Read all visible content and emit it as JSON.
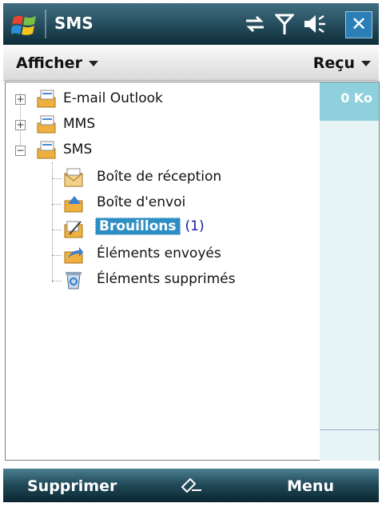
{
  "titlebar": {
    "title": "SMS"
  },
  "menubar": {
    "left_label": "Afficher",
    "right_label": "Reçu"
  },
  "tree": {
    "accounts": [
      {
        "label": "E-mail Outlook",
        "expanded": false
      },
      {
        "label": "MMS",
        "expanded": false
      },
      {
        "label": "SMS",
        "expanded": true
      }
    ],
    "folders": [
      {
        "label": "Boîte de réception",
        "icon": "inbox-icon"
      },
      {
        "label": "Boîte d'envoi",
        "icon": "outbox-icon"
      },
      {
        "label": "Brouillons",
        "count": "(1)",
        "icon": "drafts-icon",
        "selected": true
      },
      {
        "label": "Éléments envoyés",
        "icon": "sent-icon"
      },
      {
        "label": "Éléments supprimés",
        "icon": "deleted-icon"
      }
    ]
  },
  "right_panel": {
    "size": "0 Ko"
  },
  "softkeys": {
    "left": "Supprimer",
    "right": "Menu"
  },
  "colors": {
    "selection": "#2d8ec4",
    "panel_header": "#8ed1dc",
    "count": "#1a1aa3"
  }
}
